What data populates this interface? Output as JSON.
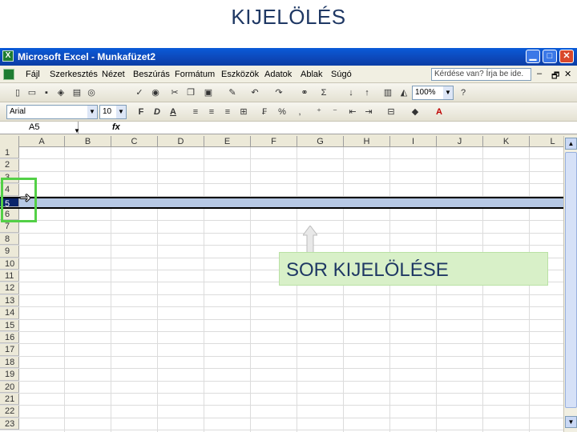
{
  "slide": {
    "title": "KIJELÖLÉS"
  },
  "window": {
    "title": "Microsoft Excel - Munkafüzet2",
    "controls": {
      "minimize": "▁",
      "maximize": "□",
      "close": "✕"
    }
  },
  "menu": {
    "items": [
      "Fájl",
      "Szerkesztés",
      "Nézet",
      "Beszúrás",
      "Formátum",
      "Eszközök",
      "Adatok",
      "Ablak",
      "Súgó"
    ],
    "help_placeholder": "Kérdése van? Írja be ide.",
    "mdi_controls": [
      "–",
      "🗗",
      "✕"
    ]
  },
  "toolbar": {
    "zoom": "100%",
    "font_name": "Arial",
    "font_size": "10",
    "bold": "F",
    "italic": "D",
    "underline": "A"
  },
  "formula_bar": {
    "name_box": "A5",
    "fx": "fx"
  },
  "sheet": {
    "columns": [
      "A",
      "B",
      "C",
      "D",
      "E",
      "F",
      "G",
      "H",
      "I",
      "J",
      "K",
      "L"
    ],
    "rows": [
      "1",
      "2",
      "3",
      "4",
      "5",
      "6",
      "7",
      "8",
      "9",
      "10",
      "11",
      "12",
      "13",
      "14",
      "15",
      "16",
      "17",
      "18",
      "19",
      "20",
      "21",
      "22",
      "23"
    ],
    "selected_row": "5"
  },
  "annotation": {
    "label": "SOR KIJELÖLÉSE",
    "highlight_color": "#53d046"
  }
}
